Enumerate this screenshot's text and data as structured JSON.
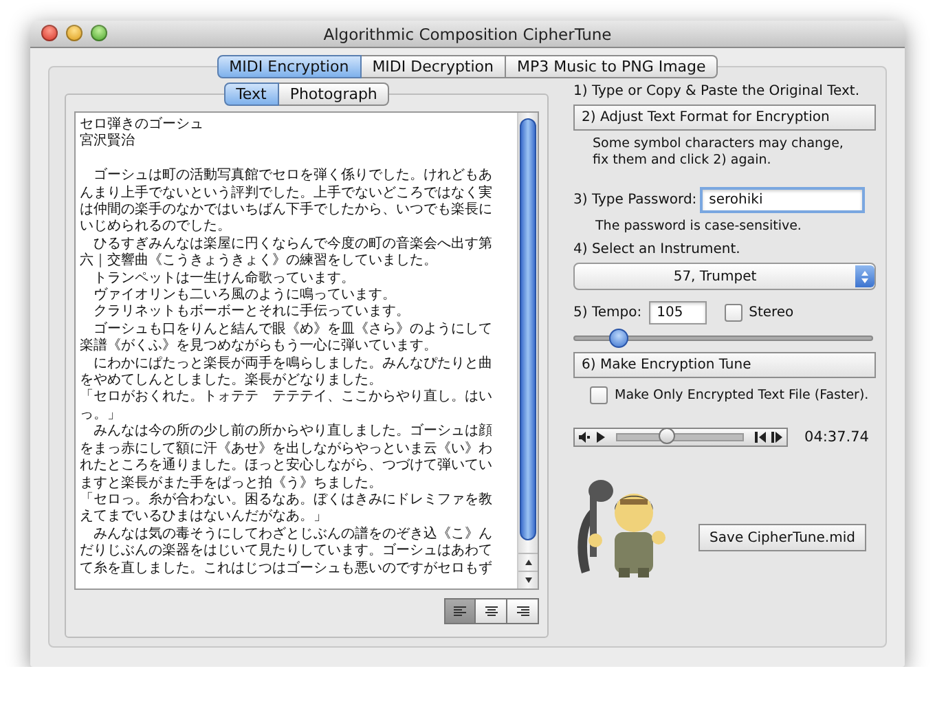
{
  "window": {
    "title": "Algorithmic Composition CipherTune"
  },
  "tabs": [
    {
      "label": "MIDI Encryption",
      "selected": true
    },
    {
      "label": "MIDI Decryption",
      "selected": false
    },
    {
      "label": "MP3 Music to PNG Image",
      "selected": false
    }
  ],
  "source_tabs": [
    {
      "label": "Text",
      "selected": true
    },
    {
      "label": "Photograph",
      "selected": false
    }
  ],
  "title_lines": [
    "セロ弾きのゴーシュ",
    "宮沢賢治"
  ],
  "text_lines": [
    "　ゴーシュは町の活動写真館でセロを弾く係りでした。けれどもあ",
    "んまり上手でないという評判でした。上手でないどころではなく実",
    "は仲間の楽手のなかではいちばん下手でしたから、いつでも楽長に",
    "いじめられるのでした。",
    "　ひるすぎみんなは楽屋に円くならんで今度の町の音楽会へ出す第",
    "六｜交響曲《こうきょうきょく》の練習をしていました。",
    "　トランペットは一生けん命歌っています。",
    "　ヴァイオリンも二いろ風のように鳴っています。",
    "　クラリネットもボーボーとそれに手伝っています。",
    "　ゴーシュも口をりんと結んで眼《め》を皿《さら》のようにして",
    "楽譜《がくふ》を見つめながらもう一心に弾いています。",
    "　にわかにぱたっと楽長が両手を鳴らしました。みんなぴたりと曲",
    "をやめてしんとしました。楽長がどなりました。",
    "「セロがおくれた。トォテテ　テテテイ、ここからやり直し。はい",
    "っ。」",
    "　みんなは今の所の少し前の所からやり直しました。ゴーシュは顔",
    "をまっ赤にして額に汗《あせ》を出しながらやっといま云《い》わ",
    "れたところを通りました。ほっと安心しながら、つづけて弾いてい",
    "ますと楽長がまた手をぱっと拍《う》ちました。",
    "「セロっ。糸が合わない。困るなあ。ぼくはきみにドレミファを教",
    "えてまでいるひまはないんだがなあ。」",
    "　みんなは気の毒そうにしてわざとじぶんの譜をのぞき込《こ》ん",
    "だりじぶんの楽器をはじいて見たりしています。ゴーシュはあわて",
    "て糸を直しました。これはじつはゴーシュも悪いのですがセロもず"
  ],
  "alignment": [
    {
      "kind": "left",
      "selected": true
    },
    {
      "kind": "center",
      "selected": false
    },
    {
      "kind": "right",
      "selected": false
    }
  ],
  "step1": "1) Type or Copy & Paste the Original Text.",
  "step2_button": "2) Adjust Text Format for Encryption",
  "step2_note": [
    "Some symbol characters may change,",
    "fix them and click 2) again."
  ],
  "password": {
    "label": "3) Type Password:",
    "value": "serohiki",
    "hint": "The password is case-sensitive."
  },
  "instrument": {
    "label": "4) Select an Instrument.",
    "value": "57, Trumpet"
  },
  "tempo": {
    "label": "5) Tempo:",
    "value": "105",
    "level": 0.15
  },
  "stereo": {
    "label": "Stereo",
    "checked": false
  },
  "step6_button": "6) Make Encryption Tune",
  "text_only": {
    "label": "Make Only Encrypted Text File (Faster).",
    "checked": false
  },
  "player": {
    "level": 0.4,
    "time": "04:37.74"
  },
  "save_button": "Save CipherTune.mid"
}
